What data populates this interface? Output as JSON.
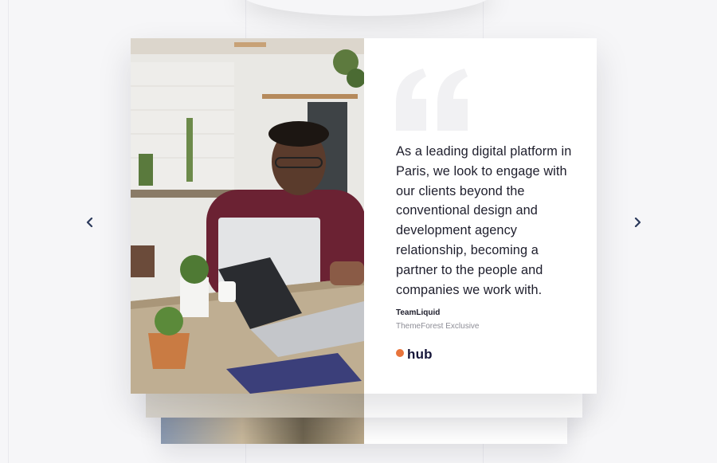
{
  "testimonial": {
    "quote": "As a leading digital platform in Paris, we look to engage with our clients beyond the conventional design and development agency relationship, becoming a partner to the people and companies we work with.",
    "author": "TeamLiquid",
    "author_role": "ThemeForest Exclusive",
    "brand": "hub",
    "photo_icon": "office-photo"
  },
  "nav": {
    "prev_icon": "chevron-left-icon",
    "next_icon": "chevron-right-icon"
  },
  "colors": {
    "accent": "#e8743b",
    "brand_text": "#16163a",
    "arrow": "#2c3a5c",
    "quote_mark": "#f1f1f3"
  }
}
